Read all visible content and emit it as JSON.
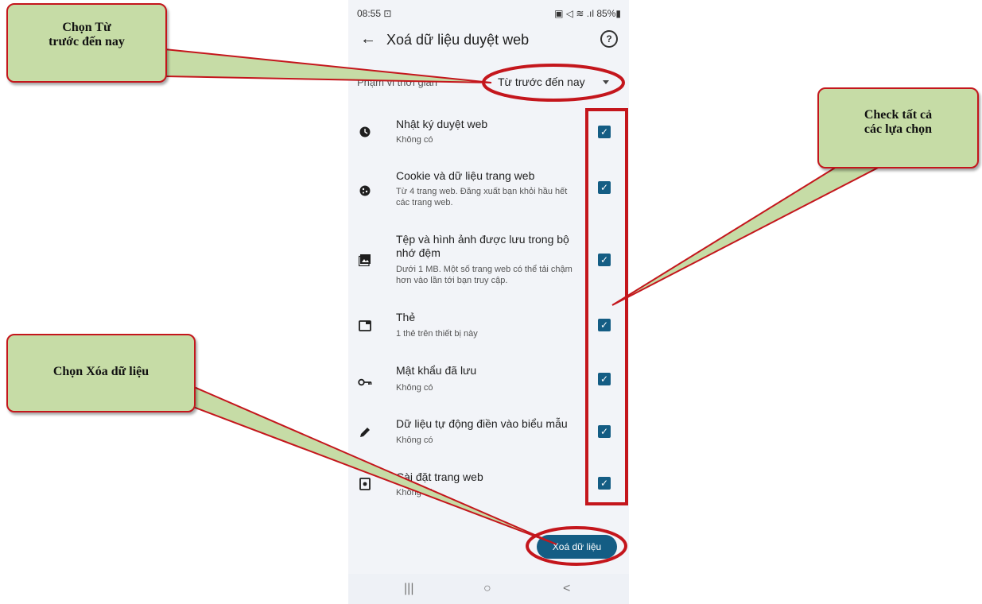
{
  "status": {
    "time": "08:55 ⊡",
    "indicators": "▣ ◁ ≋ .ıl 85%▮"
  },
  "appbar": {
    "back_icon": "arrow-left-icon",
    "title": "Xoá dữ liệu duyệt web",
    "help": "?"
  },
  "time_range": {
    "label": "Phạm vi thời gian",
    "value": "Từ trước đến nay"
  },
  "items": [
    {
      "title": "Nhật ký duyệt web",
      "subtitle": "Không có",
      "icon": "clock-icon",
      "checked": true
    },
    {
      "title": "Cookie và dữ liệu trang web",
      "subtitle": "Từ 4 trang web. Đăng xuất bạn khỏi hầu hết các trang web.",
      "icon": "cookie-icon",
      "checked": true
    },
    {
      "title": "Tệp và hình ảnh được lưu trong bộ nhớ đệm",
      "subtitle": "Dưới 1 MB. Một số trang web có thể tải chậm hơn vào lần tới bạn truy cập.",
      "icon": "image-icon",
      "checked": true
    },
    {
      "title": "Thẻ",
      "subtitle": "1 thẻ trên thiết bị này",
      "icon": "tab-icon",
      "checked": true
    },
    {
      "title": "Mật khẩu đã lưu",
      "subtitle": "Không có",
      "icon": "key-icon",
      "checked": true
    },
    {
      "title": "Dữ liệu tự động điền vào biểu mẫu",
      "subtitle": "Không có",
      "icon": "pen-icon",
      "checked": true
    },
    {
      "title": "Cài đặt trang web",
      "subtitle": "Không có",
      "icon": "settings-icon",
      "checked": true
    }
  ],
  "delete_button": "Xoá dữ liệu",
  "navbar": {
    "recent": "|||",
    "home": "○",
    "back": "<"
  },
  "callouts": {
    "range_line1": "Chọn Từ",
    "range_line2": "trước đến nay",
    "check_line1": "Check tất cả",
    "check_line2": "các lựa chọn",
    "delete": "Chọn Xóa dữ liệu"
  },
  "colors": {
    "accent": "#145d84",
    "callout_fill": "#c6dca6",
    "callout_border": "#c4161c"
  }
}
